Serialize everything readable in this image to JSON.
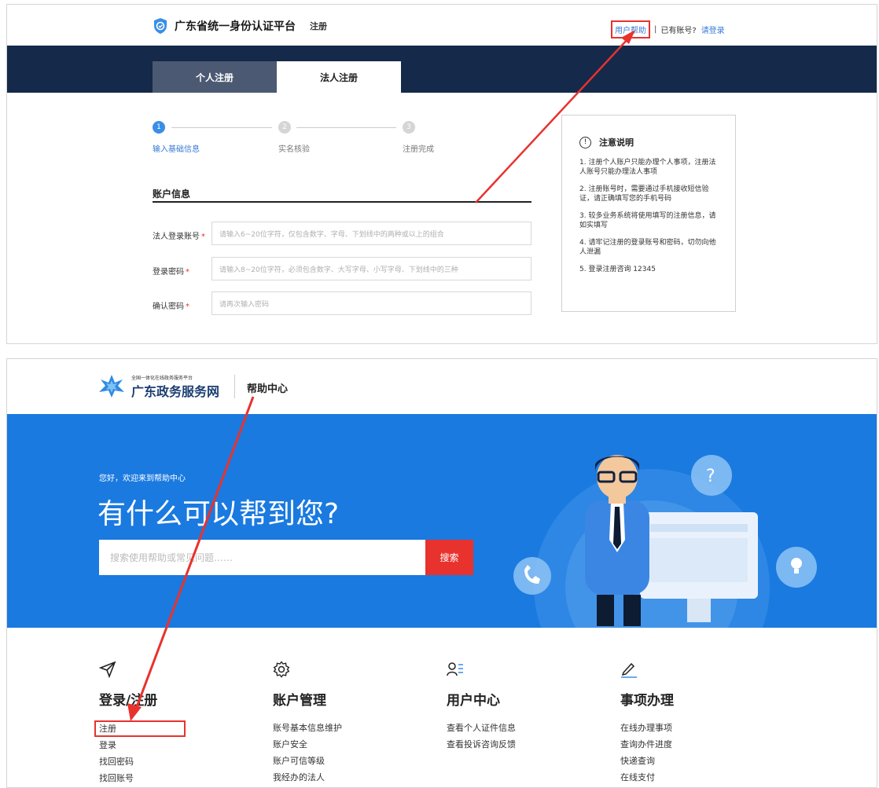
{
  "top": {
    "brand_title": "广东省统一身份认证平台",
    "brand_sub": "注册",
    "help_link": "用户帮助",
    "separator": "|",
    "has_account": "已有账号?",
    "login_link": "请登录",
    "tabs": [
      {
        "label": "个人注册",
        "active": false
      },
      {
        "label": "法人注册",
        "active": true
      }
    ],
    "steps": [
      {
        "num": "1",
        "label": "输入基础信息",
        "active": true
      },
      {
        "num": "2",
        "label": "实名核验",
        "active": false
      },
      {
        "num": "3",
        "label": "注册完成",
        "active": false
      }
    ],
    "section_title": "账户信息",
    "fields": [
      {
        "label": "法人登录账号",
        "required": "*",
        "placeholder": "请输入6~20位字符，仅包含数字、字母、下划线中的两种或以上的组合"
      },
      {
        "label": "登录密码",
        "required": "*",
        "placeholder": "请输入8~20位字符，必须包含数字、大写字母、小写字母、下划线中的三种"
      },
      {
        "label": "确认密码",
        "required": "*",
        "placeholder": "请再次输入密码"
      }
    ],
    "notice": {
      "icon": "!",
      "title": "注意说明",
      "items": [
        "1. 注册个人账户只能办理个人事项，注册法人账号只能办理法人事项",
        "2. 注册账号时，需要通过手机接收短信验证，请正确填写您的手机号码",
        "3. 较多业务系统将使用填写的注册信息，请如实填写",
        "4. 请牢记注册的登录账号和密码，切勿向他人泄漏",
        "5. 登录注册咨询 12345"
      ]
    }
  },
  "bottom": {
    "logo_small": "全国一体化在线政务服务平台",
    "logo_big": "广东政务服务网",
    "help_center": "帮助中心",
    "welcome": "您好，欢迎来到帮助中心",
    "headline": "有什么可以帮到您?",
    "search_placeholder": "搜索使用帮助或常见问题……",
    "search_button": "搜索",
    "categories": [
      {
        "icon": "send-icon",
        "title": "登录/注册",
        "items": [
          "注册",
          "登录",
          "找回密码",
          "找回账号"
        ]
      },
      {
        "icon": "gear-icon",
        "title": "账户管理",
        "items": [
          "账号基本信息维护",
          "账户安全",
          "账户可信等级",
          "我经办的法人"
        ]
      },
      {
        "icon": "user-list-icon",
        "title": "用户中心",
        "items": [
          "查看个人证件信息",
          "查看投诉咨询反馈"
        ]
      },
      {
        "icon": "pencil-icon",
        "title": "事项办理",
        "items": [
          "在线办理事项",
          "查询办件进度",
          "快递查询",
          "在线支付"
        ]
      }
    ]
  },
  "colors": {
    "accent": "#3a7bd5",
    "nav": "#15294a",
    "banner": "#1a7ae0",
    "highlight": "#e8322e"
  }
}
